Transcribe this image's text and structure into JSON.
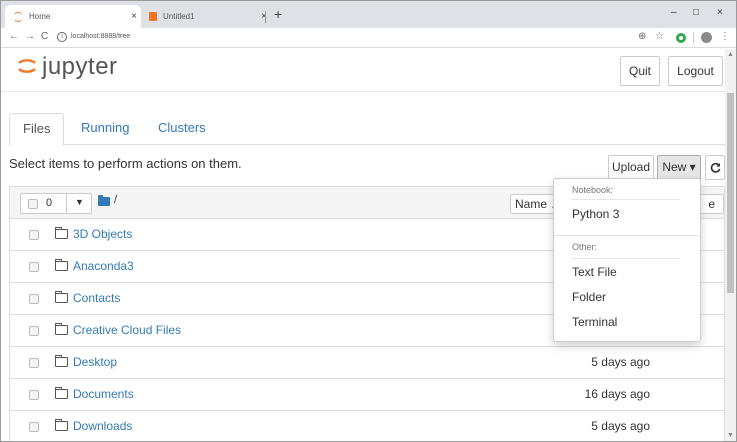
{
  "browser": {
    "tabs": [
      {
        "label": "Home",
        "close": "×"
      },
      {
        "label": "Untitled1",
        "close": "×"
      }
    ],
    "new_tab": "+",
    "window_controls": {
      "minimize": "–",
      "maximize": "□",
      "close": "×"
    },
    "address": "localhost:8888/tree",
    "nav": {
      "back": "←",
      "forward": "→",
      "reload": "C",
      "info": "i"
    },
    "toolbar_icons": {
      "zoom": "⊕",
      "star": "☆",
      "menu": "⋮"
    }
  },
  "header": {
    "logo_text": "jupyter",
    "quit_label": "Quit",
    "logout_label": "Logout",
    "accent_color": "#f37626"
  },
  "tabs": [
    {
      "label": "Files"
    },
    {
      "label": "Running"
    },
    {
      "label": "Clusters"
    }
  ],
  "toolbar": {
    "instructions": "Select items to perform actions on them.",
    "upload_label": "Upload",
    "new_label": "New ▾",
    "refresh_icon": "refresh-icon"
  },
  "list_header": {
    "selected_count": "0",
    "breadcrumb": "/",
    "name_sort_label": "Name ↓",
    "last_modified_partial": "e"
  },
  "files": [
    {
      "name": "3D Objects",
      "modified": ""
    },
    {
      "name": "Anaconda3",
      "modified": ""
    },
    {
      "name": "Contacts",
      "modified": ""
    },
    {
      "name": "Creative Cloud Files",
      "modified": ""
    },
    {
      "name": "Desktop",
      "modified": "5 days ago"
    },
    {
      "name": "Documents",
      "modified": "16 days ago"
    },
    {
      "name": "Downloads",
      "modified": "5 days ago"
    }
  ],
  "new_menu": {
    "notebook_header": "Notebook:",
    "notebook_items": [
      "Python 3"
    ],
    "other_header": "Other:",
    "other_items": [
      "Text File",
      "Folder",
      "Terminal"
    ]
  }
}
